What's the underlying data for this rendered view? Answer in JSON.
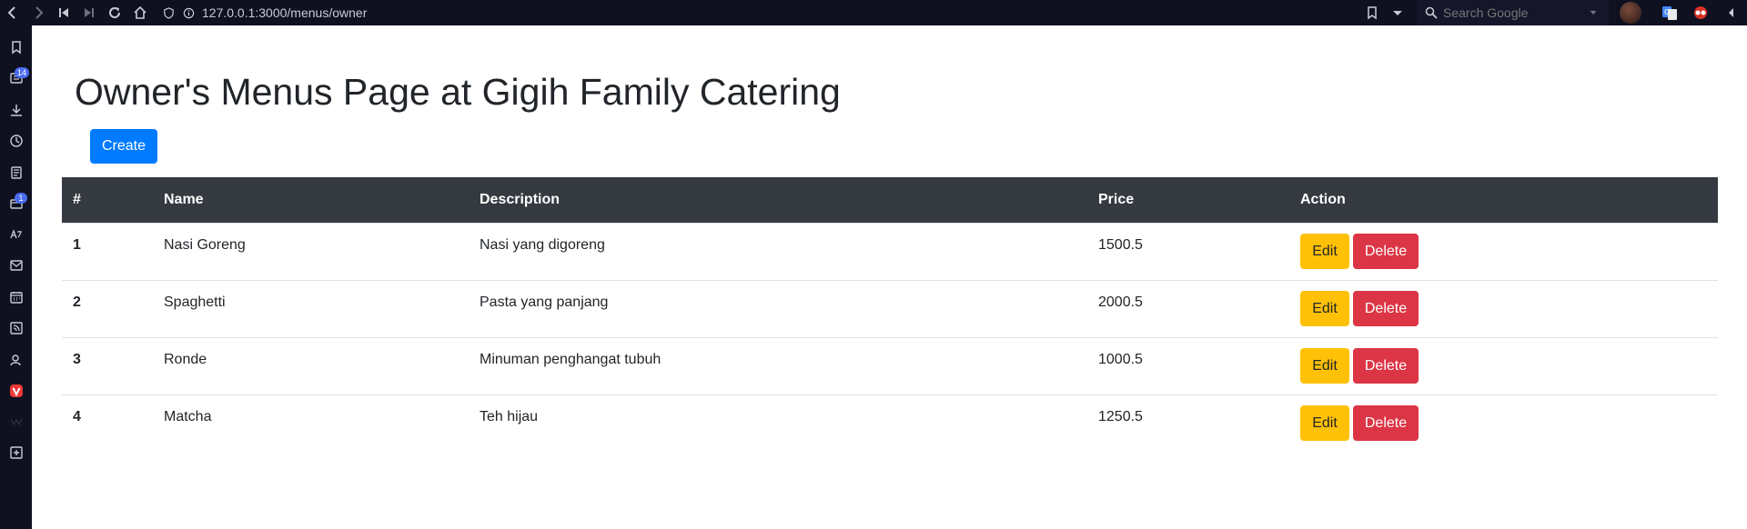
{
  "browser": {
    "url": "127.0.0.1:3000/menus/owner",
    "search_placeholder": "Search Google",
    "sidebar_badges": {
      "reading_list": "14",
      "mail": "1"
    }
  },
  "page": {
    "title": "Owner's Menus Page at Gigih Family Catering",
    "create_label": "Create"
  },
  "table": {
    "headers": {
      "index": "#",
      "name": "Name",
      "description": "Description",
      "price": "Price",
      "action": "Action"
    },
    "rows": [
      {
        "index": "1",
        "name": "Nasi Goreng",
        "description": "Nasi yang digoreng",
        "price": "1500.5",
        "edit": "Edit",
        "delete": "Delete"
      },
      {
        "index": "2",
        "name": "Spaghetti",
        "description": "Pasta yang panjang",
        "price": "2000.5",
        "edit": "Edit",
        "delete": "Delete"
      },
      {
        "index": "3",
        "name": "Ronde",
        "description": "Minuman penghangat tubuh",
        "price": "1000.5",
        "edit": "Edit",
        "delete": "Delete"
      },
      {
        "index": "4",
        "name": "Matcha",
        "description": "Teh hijau",
        "price": "1250.5",
        "edit": "Edit",
        "delete": "Delete"
      }
    ]
  },
  "colors": {
    "primary": "#007bff",
    "warning": "#ffc107",
    "danger": "#dc3545",
    "table_header": "#343a40",
    "browser_chrome": "#0f1020"
  }
}
